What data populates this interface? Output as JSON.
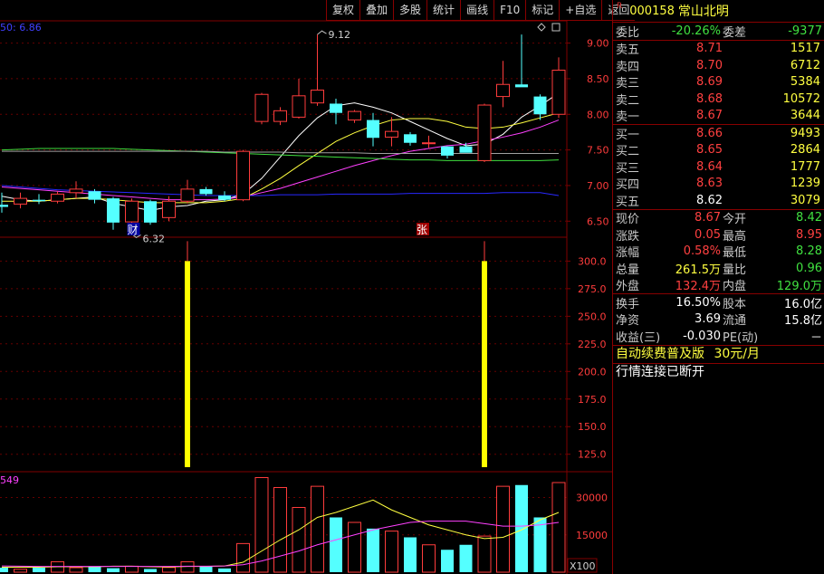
{
  "toolbar": {
    "items": [
      "复权",
      "叠加",
      "多股",
      "统计",
      "画线",
      "F10",
      "标记",
      "+自选",
      "返回"
    ]
  },
  "header": {
    "badge": "R",
    "code": "000158",
    "name": "常山北明"
  },
  "main_chart": {
    "ma_label": "50: 6.86",
    "max_label": "9.12",
    "min_label": "6.32",
    "marker_cai": "财",
    "marker_zhang": "张",
    "price_ticks": [
      "9.00",
      "8.50",
      "8.00",
      "7.50",
      "7.00",
      "6.50"
    ],
    "indicator_ticks": [
      "300.0",
      "275.0",
      "250.0",
      "225.0",
      "200.0",
      "175.0",
      "150.0",
      "125.0"
    ],
    "volume_label": "549",
    "volume_ticks": [
      "30000",
      "15000"
    ],
    "volume_unit": "X100"
  },
  "chart_data": {
    "type": "candlestick",
    "price_axis": [
      6.3,
      9.3
    ],
    "candles": [
      {
        "o": 6.73,
        "h": 6.9,
        "l": 6.62,
        "c": 6.7
      },
      {
        "o": 6.74,
        "h": 6.9,
        "l": 6.68,
        "c": 6.82
      },
      {
        "o": 6.8,
        "h": 6.88,
        "l": 6.74,
        "c": 6.78
      },
      {
        "o": 6.78,
        "h": 6.92,
        "l": 6.75,
        "c": 6.88
      },
      {
        "o": 6.9,
        "h": 7.06,
        "l": 6.82,
        "c": 6.95
      },
      {
        "o": 6.92,
        "h": 6.95,
        "l": 6.75,
        "c": 6.8
      },
      {
        "o": 6.82,
        "h": 6.84,
        "l": 6.38,
        "c": 6.48
      },
      {
        "o": 6.49,
        "h": 6.82,
        "l": 6.32,
        "c": 6.78
      },
      {
        "o": 6.78,
        "h": 6.8,
        "l": 6.45,
        "c": 6.48
      },
      {
        "o": 6.55,
        "h": 6.85,
        "l": 6.5,
        "c": 6.78
      },
      {
        "o": 6.78,
        "h": 7.08,
        "l": 6.75,
        "c": 6.95
      },
      {
        "o": 6.95,
        "h": 6.98,
        "l": 6.86,
        "c": 6.88
      },
      {
        "o": 6.86,
        "h": 6.92,
        "l": 6.78,
        "c": 6.8
      },
      {
        "o": 6.8,
        "h": 7.5,
        "l": 6.78,
        "c": 7.48
      },
      {
        "o": 7.9,
        "h": 8.3,
        "l": 7.86,
        "c": 8.28
      },
      {
        "o": 7.9,
        "h": 8.1,
        "l": 7.85,
        "c": 8.05
      },
      {
        "o": 7.96,
        "h": 8.5,
        "l": 7.94,
        "c": 8.26
      },
      {
        "o": 8.16,
        "h": 9.12,
        "l": 8.12,
        "c": 8.34
      },
      {
        "o": 8.15,
        "h": 8.22,
        "l": 7.86,
        "c": 8.02
      },
      {
        "o": 7.92,
        "h": 8.06,
        "l": 7.88,
        "c": 8.04
      },
      {
        "o": 7.92,
        "h": 8.02,
        "l": 7.55,
        "c": 7.67
      },
      {
        "o": 7.68,
        "h": 7.96,
        "l": 7.55,
        "c": 7.76
      },
      {
        "o": 7.72,
        "h": 7.75,
        "l": 7.56,
        "c": 7.6
      },
      {
        "o": 7.6,
        "h": 7.7,
        "l": 7.53,
        "c": 7.6
      },
      {
        "o": 7.55,
        "h": 7.55,
        "l": 7.38,
        "c": 7.42
      },
      {
        "o": 7.55,
        "h": 7.6,
        "l": 7.48,
        "c": 7.46
      },
      {
        "o": 7.35,
        "h": 8.15,
        "l": 7.33,
        "c": 8.13
      },
      {
        "o": 8.25,
        "h": 8.75,
        "l": 8.1,
        "c": 8.42
      },
      {
        "o": 8.42,
        "h": 9.12,
        "l": 8.4,
        "c": 8.38
      },
      {
        "o": 8.25,
        "h": 8.28,
        "l": 7.92,
        "c": 8.0
      },
      {
        "o": 8.0,
        "h": 8.8,
        "l": 7.95,
        "c": 8.62
      }
    ],
    "ma_lines": [
      {
        "color": "#ffffff",
        "values": [
          6.85,
          6.8,
          6.78,
          6.8,
          6.82,
          6.84,
          6.75,
          6.7,
          6.65,
          6.7,
          6.72,
          6.78,
          6.8,
          6.88,
          7.1,
          7.4,
          7.7,
          7.95,
          8.12,
          8.16,
          8.1,
          8.02,
          7.9,
          7.78,
          7.66,
          7.56,
          7.58,
          7.72,
          7.96,
          8.12,
          8.3
        ]
      },
      {
        "color": "#ffff40",
        "values": [
          6.78,
          6.78,
          6.78,
          6.8,
          6.82,
          6.82,
          6.8,
          6.78,
          6.76,
          6.76,
          6.76,
          6.76,
          6.78,
          6.82,
          6.95,
          7.1,
          7.28,
          7.45,
          7.62,
          7.74,
          7.84,
          7.92,
          7.94,
          7.94,
          7.9,
          7.82,
          7.8,
          7.82,
          7.88,
          7.95,
          8.02
        ]
      },
      {
        "color": "#ff40ff",
        "values": [
          6.98,
          6.96,
          6.94,
          6.92,
          6.9,
          6.88,
          6.86,
          6.84,
          6.82,
          6.8,
          6.8,
          6.8,
          6.81,
          6.84,
          6.9,
          6.96,
          7.04,
          7.12,
          7.2,
          7.28,
          7.35,
          7.42,
          7.48,
          7.52,
          7.56,
          7.58,
          7.63,
          7.68,
          7.74,
          7.82,
          7.92
        ]
      },
      {
        "color": "#40e040",
        "values": [
          7.5,
          7.51,
          7.52,
          7.52,
          7.52,
          7.52,
          7.52,
          7.51,
          7.5,
          7.49,
          7.48,
          7.47,
          7.46,
          7.45,
          7.44,
          7.43,
          7.42,
          7.41,
          7.4,
          7.39,
          7.38,
          7.37,
          7.36,
          7.36,
          7.35,
          7.35,
          7.35,
          7.35,
          7.35,
          7.35,
          7.36
        ]
      },
      {
        "color": "#a0a0a0",
        "values": [
          7.48,
          7.48,
          7.48,
          7.48,
          7.48,
          7.48,
          7.48,
          7.48,
          7.48,
          7.48,
          7.48,
          7.48,
          7.47,
          7.47,
          7.47,
          7.47,
          7.46,
          7.46,
          7.46,
          7.46,
          7.45,
          7.45,
          7.45,
          7.45,
          7.45,
          7.45,
          7.45,
          7.45,
          7.45,
          7.45,
          7.45
        ]
      },
      {
        "color": "#2828ff",
        "values": [
          7.0,
          6.98,
          6.96,
          6.94,
          6.93,
          6.92,
          6.91,
          6.9,
          6.89,
          6.88,
          6.87,
          6.86,
          6.86,
          6.86,
          6.86,
          6.87,
          6.87,
          6.87,
          6.88,
          6.88,
          6.88,
          6.88,
          6.89,
          6.89,
          6.89,
          6.89,
          6.89,
          6.9,
          6.9,
          6.9,
          6.86
        ]
      }
    ],
    "indicator_axis": [
      110,
      320
    ],
    "indicator_bars": [
      {
        "index": 10,
        "value": 300
      },
      {
        "index": 26,
        "value": 300
      }
    ],
    "volume_axis": [
      0,
      40000
    ],
    "volume": [
      1800,
      1200,
      1800,
      4200,
      1800,
      2400,
      1600,
      2400,
      1300,
      1900,
      4200,
      2300,
      1500,
      11500,
      38000,
      34000,
      26000,
      34500,
      22000,
      20000,
      17500,
      16500,
      14000,
      11000,
      9000,
      11000,
      14500,
      34500,
      35000,
      22000,
      36000
    ],
    "vol_ma_lines": [
      {
        "color": "#ffff40",
        "values": [
          2000,
          2000,
          2000,
          2200,
          2200,
          2200,
          2400,
          2400,
          2200,
          2100,
          2300,
          2300,
          2500,
          4000,
          8500,
          13000,
          17000,
          22000,
          24000,
          26500,
          29000,
          25000,
          22000,
          19000,
          17000,
          15000,
          13500,
          14000,
          17000,
          21000,
          24000
        ]
      },
      {
        "color": "#ff40ff",
        "values": [
          2500,
          2400,
          2300,
          2300,
          2300,
          2300,
          2300,
          2300,
          2300,
          2300,
          2400,
          2400,
          2500,
          3000,
          4500,
          6500,
          8500,
          11000,
          13000,
          15000,
          17000,
          18500,
          20000,
          20500,
          20500,
          20500,
          19500,
          18500,
          18500,
          19000,
          20000
        ]
      }
    ]
  },
  "quote": {
    "weibi": {
      "label": "委比",
      "value": "-20.26%",
      "label2": "委差",
      "value2": "-9377"
    },
    "sells": [
      {
        "label": "卖五",
        "price": "8.71",
        "vol": "1517"
      },
      {
        "label": "卖四",
        "price": "8.70",
        "vol": "6712"
      },
      {
        "label": "卖三",
        "price": "8.69",
        "vol": "5384"
      },
      {
        "label": "卖二",
        "price": "8.68",
        "vol": "10572"
      },
      {
        "label": "卖一",
        "price": "8.67",
        "vol": "3644"
      }
    ],
    "buys": [
      {
        "label": "买一",
        "price": "8.66",
        "vol": "9493"
      },
      {
        "label": "买二",
        "price": "8.65",
        "vol": "2864"
      },
      {
        "label": "买三",
        "price": "8.64",
        "vol": "1777"
      },
      {
        "label": "买四",
        "price": "8.63",
        "vol": "1239"
      },
      {
        "label": "买五",
        "price": "8.62",
        "vol": "3079"
      }
    ],
    "stats": [
      {
        "l1": "现价",
        "v1": "8.67",
        "l2": "今开",
        "v2": "8.42"
      },
      {
        "l1": "涨跌",
        "v1": "0.05",
        "l2": "最高",
        "v2": "8.95"
      },
      {
        "l1": "涨幅",
        "v1": "0.58%",
        "l2": "最低",
        "v2": "8.28"
      },
      {
        "l1": "总量",
        "v1": "261.5万",
        "l2": "量比",
        "v2": "0.96"
      },
      {
        "l1": "外盘",
        "v1": "132.4万",
        "l2": "内盘",
        "v2": "129.0万"
      }
    ],
    "fund": [
      {
        "l1": "换手",
        "v1": "16.50%",
        "l2": "股本",
        "v2": "16.0亿"
      },
      {
        "l1": "净资",
        "v1": "3.69",
        "l2": "流通",
        "v2": "15.8亿"
      },
      {
        "l1": "收益(三)",
        "v1": "-0.030",
        "l2": "PE(动)",
        "v2": "－"
      }
    ],
    "notice1": "自动续费普及版",
    "notice1_price": "30元/月",
    "notice2": "行情连接已断开"
  }
}
